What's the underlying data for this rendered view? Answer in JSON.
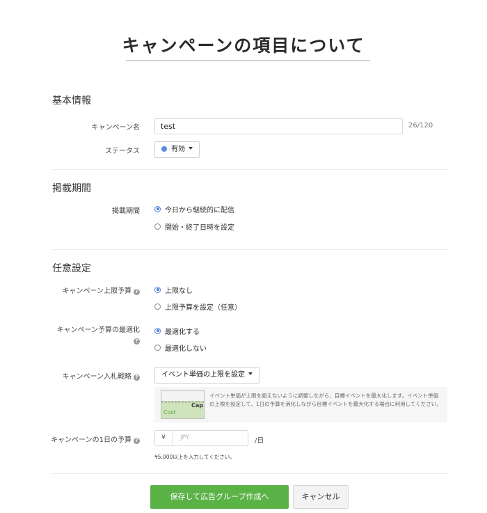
{
  "page_title": "キャンペーンの項目について",
  "sections": {
    "basic": {
      "title": "基本情報",
      "campaign_name_label": "キャンペーン名",
      "campaign_name_value": "test",
      "campaign_name_counter": "26/120",
      "status_label": "ステータス",
      "status_value": "有効"
    },
    "period": {
      "title": "掲載期間",
      "label": "掲載期間",
      "options": [
        "今日から継続的に配信",
        "開始・終了日時を設定"
      ],
      "selected_index": 0
    },
    "optional": {
      "title": "任意設定",
      "budget_cap_label": "キャンペーン上限予算",
      "budget_cap_options": [
        "上限なし",
        "上限予算を設定（任意）"
      ],
      "budget_cap_selected_index": 0,
      "budget_opt_label": "キャンペーン予算の最適化",
      "budget_opt_options": [
        "最適化する",
        "最適化しない"
      ],
      "budget_opt_selected_index": 0,
      "bid_strategy_label": "キャンペーン入札戦略",
      "bid_strategy_value": "イベント単価の上限を設定",
      "bid_info_text": "イベント単価が上限を超えないように調整しながら、目標イベントを最大化します。イベント単価の上限を設定して、1日の予算を消化しながら目標イベントを最大化する場合に利用してください。",
      "bid_info_image": {
        "cap_label": "Cap",
        "cost_label": "Cost"
      },
      "daily_budget_label": "キャンペーンの1日の予算",
      "currency_symbol": "¥",
      "daily_budget_placeholder": "JPY",
      "per_day": "/日",
      "daily_budget_hint": "¥5,000以上を入力してください。"
    }
  },
  "buttons": {
    "save": "保存して広告グループ作成へ",
    "cancel": "キャンセル"
  },
  "colors": {
    "primary_green": "#5bb247",
    "radio_blue": "#4a80d8",
    "status_dot": "#5b8de0"
  },
  "icons": {
    "help": "question-circle-icon",
    "dropdown": "caret-down-icon"
  }
}
